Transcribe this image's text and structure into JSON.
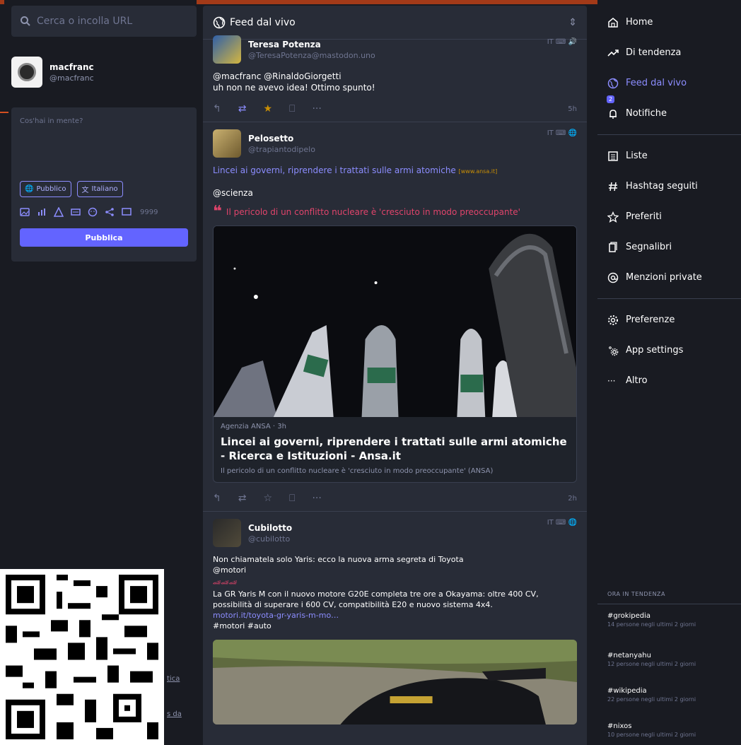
{
  "search": {
    "placeholder": "Cerca o incolla URL"
  },
  "account": {
    "name": "macfranc",
    "handle": "@macfranc"
  },
  "composer": {
    "placeholder": "Cos'hai in mente?",
    "visibility_label": "Pubblico",
    "language_label": "Italiano",
    "char_counter": "9999",
    "publish_label": "Pubblica"
  },
  "left_links": {
    "link1": "tica",
    "link2": "s da"
  },
  "column": {
    "title": "Feed dal vivo"
  },
  "statuses": [
    {
      "name": "Teresa Potenza",
      "handle": "@TeresaPotenza@mastodon.uno",
      "meta": "IT ⌨ 🔊",
      "text_line1": "@macfranc @RinaldoGiorgetti",
      "text_line2": "uh non ne avevo idea! Ottimo spunto!",
      "time": "5h"
    },
    {
      "name": "Pelosetto",
      "handle": "@trapiantodipelo",
      "meta": "IT ⌨ 🌐",
      "link_text": "Lincei ai governi, riprendere i trattati sulle armi atomiche",
      "link_domain": "[www.ansa.it]",
      "mention": "@scienza",
      "quote": "Il pericolo di un conflitto nucleare è 'cresciuto in modo preoccupante'",
      "card_source": "Agenzia ANSA · 3h",
      "card_title": "Lincei ai governi, riprendere i trattati sulle armi atomiche - Ricerca e Istituzioni - Ansa.it",
      "card_desc": "Il pericolo di un conflitto nucleare è 'cresciuto in modo preoccupante' (ANSA)",
      "time": "2h"
    },
    {
      "name": "Cubilotto",
      "handle": "@cubilotto",
      "meta": "IT ⌨ 🌐",
      "text_line1": "Non chiamatela solo Yaris: ecco la nuova arma segreta di Toyota",
      "text_line2": "@motori",
      "emoji": "🏎🏎🏎",
      "text_line3": "La GR Yaris M con il nuovo motore G20E completa tre ore a Okayama: oltre 400 CV, possibilità di superare i 600 CV, compatibilità E20 e nuovo sistema 4x4.",
      "link": "motori.it/toyota-gr-yaris-m-mo…",
      "tags": "#motori #auto"
    }
  ],
  "nav": {
    "items": [
      {
        "label": "Home",
        "icon": "home-icon"
      },
      {
        "label": "Di tendenza",
        "icon": "trending-icon"
      },
      {
        "label": "Feed dal vivo",
        "icon": "globe-icon"
      },
      {
        "label": "Notifiche",
        "icon": "bell-icon",
        "badge": "2"
      }
    ],
    "items2": [
      {
        "label": "Liste",
        "icon": "list-icon"
      },
      {
        "label": "Hashtag seguiti",
        "icon": "hashtag-icon"
      },
      {
        "label": "Preferiti",
        "icon": "star-icon"
      },
      {
        "label": "Segnalibri",
        "icon": "bookmark-icon"
      },
      {
        "label": "Menzioni private",
        "icon": "at-icon"
      }
    ],
    "items3": [
      {
        "label": "Preferenze",
        "icon": "gear-icon"
      },
      {
        "label": "App settings",
        "icon": "app-settings-icon"
      },
      {
        "label": "Altro",
        "icon": "more-icon"
      }
    ]
  },
  "trends": {
    "title": "ORA IN TENDENZA",
    "items": [
      {
        "tag": "#grokipedia",
        "sub": "14 persone negli ultimi 2 giorni"
      },
      {
        "tag": "#netanyahu",
        "sub": "12 persone negli ultimi 2 giorni"
      },
      {
        "tag": "#wikipedia",
        "sub": "22 persone negli ultimi 2 giorni"
      },
      {
        "tag": "#nixos",
        "sub": "10 persone negli ultimi 2 giorni"
      }
    ]
  },
  "colors": {
    "accent": "#6364ff",
    "accent_light": "#8c8dff",
    "quote": "#e0446b",
    "favourite": "#ca8f04",
    "background": "#191b22",
    "panel": "#282c37"
  }
}
